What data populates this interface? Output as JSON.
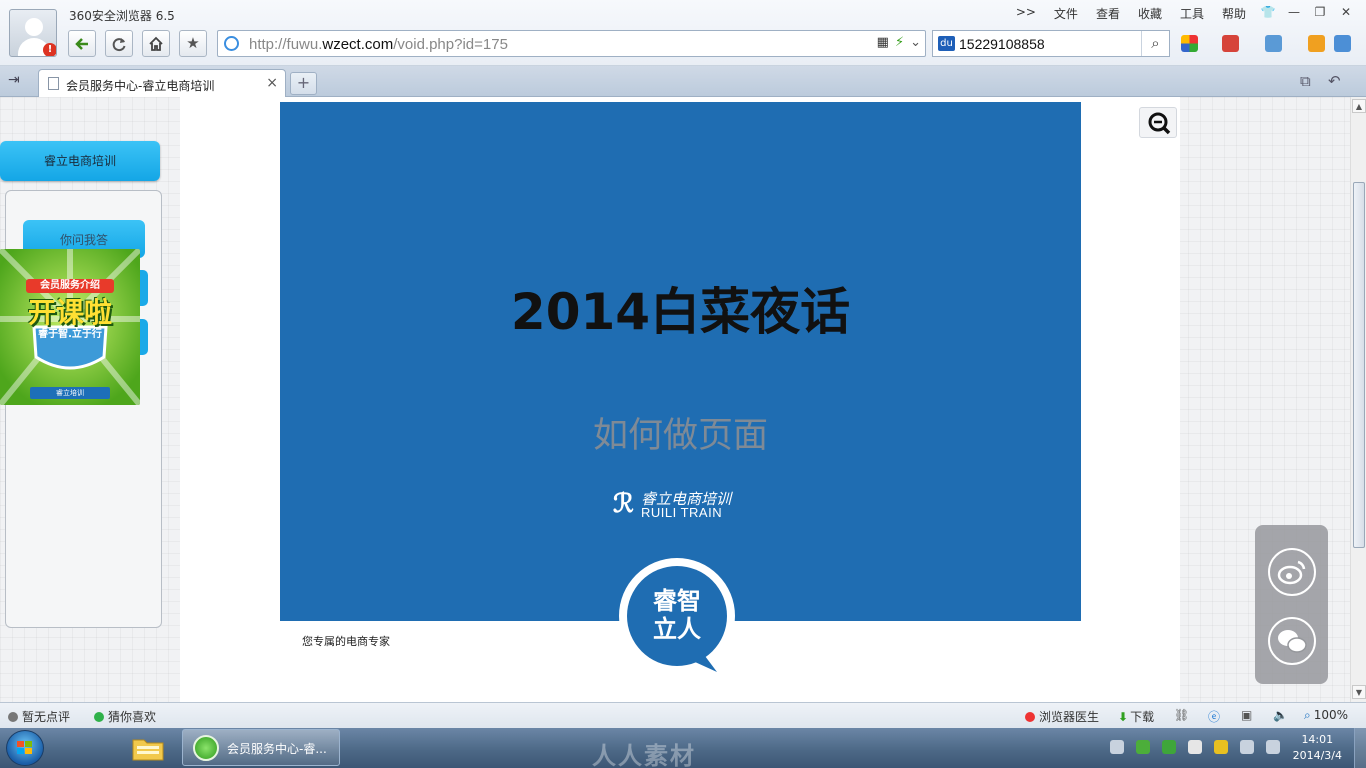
{
  "browser": {
    "title": "360安全浏览器 6.5",
    "menu": [
      ">>",
      "文件",
      "查看",
      "收藏",
      "工具",
      "帮助"
    ],
    "address": {
      "prefix": "http://fuwu.",
      "domain": "wzect.com",
      "path": "/void.php?id=175"
    },
    "search": {
      "query": "15229108858"
    },
    "tab": {
      "label": "会员服务中心-睿立电商培训"
    }
  },
  "page": {
    "left_button": "睿立电商培训",
    "left_sub": "你问我答",
    "promo": {
      "ribbon": "会员服务介绍",
      "headline": "开课啦",
      "motto": "睿于智.立于行",
      "footer": "睿立培训"
    },
    "slide": {
      "title": "2014白菜夜话",
      "subtitle": "如何做页面",
      "logo_cn": "睿立电商培训",
      "logo_en": "RUILI TRAIN",
      "badge_line1": "睿智",
      "badge_line2": "立人"
    },
    "tagline": "您专属的电商专家"
  },
  "statusbar": {
    "rating": "暂无点评",
    "guess": "猜你喜欢",
    "doctor": "浏览器医生",
    "download": "下载",
    "zoom": "100%"
  },
  "taskbar": {
    "task_label": "会员服务中心-睿...",
    "watermark": "人人素材",
    "time": "14:01",
    "date": "2014/3/4"
  },
  "colors": {
    "slide_bg": "#1f6db2",
    "accent_button": "#14a6e6",
    "promo_green": "#6cbf2c"
  }
}
